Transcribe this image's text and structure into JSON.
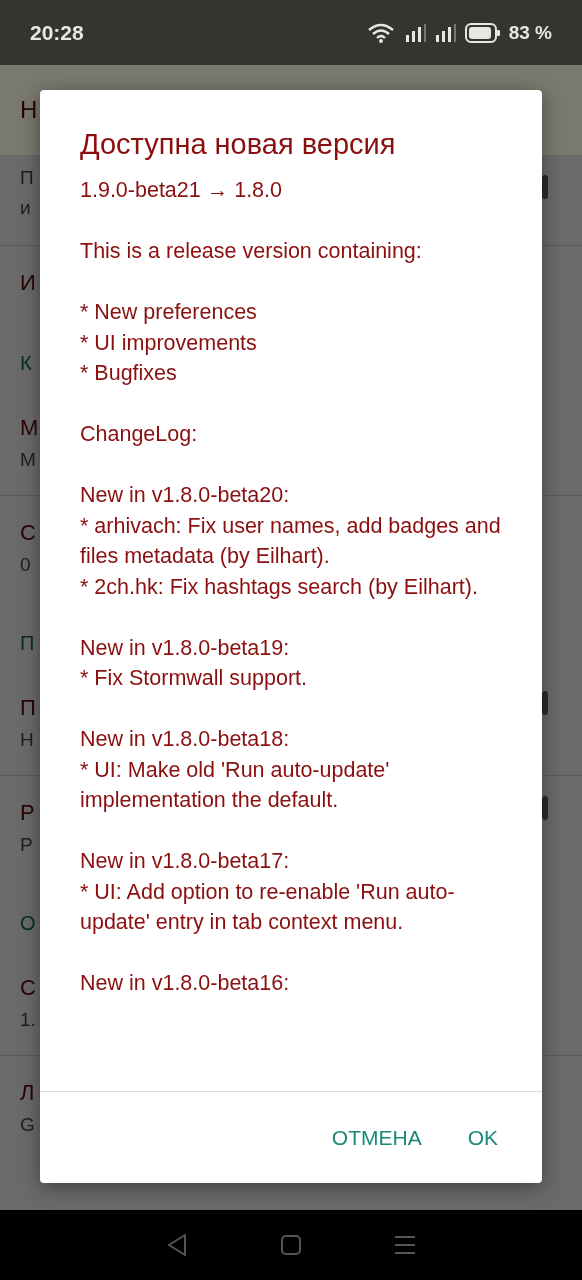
{
  "status_bar": {
    "time": "20:28",
    "battery": "83 %"
  },
  "toolbar": {
    "title": "Н"
  },
  "preferences": [
    {
      "kind": "pref",
      "summary": [
        "П",
        "и"
      ],
      "switch": true
    },
    {
      "kind": "divider"
    },
    {
      "kind": "pref",
      "title": "И"
    },
    {
      "kind": "header",
      "title": "К"
    },
    {
      "kind": "pref",
      "title": "М",
      "summary": [
        "М"
      ]
    },
    {
      "kind": "divider"
    },
    {
      "kind": "pref",
      "title": "С",
      "summary": [
        "0"
      ]
    },
    {
      "kind": "header",
      "title": "П"
    },
    {
      "kind": "pref",
      "title": "П",
      "summary": [
        "Н"
      ],
      "switch": true
    },
    {
      "kind": "divider"
    },
    {
      "kind": "pref",
      "title": "Р",
      "summary": [
        "Р"
      ],
      "switch": true
    },
    {
      "kind": "header",
      "title": "О"
    },
    {
      "kind": "pref",
      "title": "С",
      "summary": [
        "1."
      ]
    },
    {
      "kind": "divider"
    },
    {
      "kind": "pref",
      "title": "Л",
      "summary": [
        "G"
      ]
    }
  ],
  "dialog": {
    "title": "Доступна новая версия",
    "version": "1.9.0-beta21 → 1.8.0",
    "message": "This is a release version containing:\n\n* New preferences\n* UI improvements\n* Bugfixes\n\nChangeLog:\n\nNew in v1.8.0-beta20:\n* arhivach: Fix user names, add badges and files metadata (by Eilhart).\n* 2ch.hk: Fix hashtags search (by Eilhart).\n\nNew in v1.8.0-beta19:\n* Fix Stormwall support.\n\nNew in v1.8.0-beta18:\n* UI: Make old 'Run auto-update' implementation the default.\n\nNew in v1.8.0-beta17:\n* UI: Add option to re-enable 'Run auto-update' entry in tab context menu.\n\nNew in v1.8.0-beta16:",
    "buttons": [
      "ОТМЕНА",
      "OK"
    ]
  }
}
